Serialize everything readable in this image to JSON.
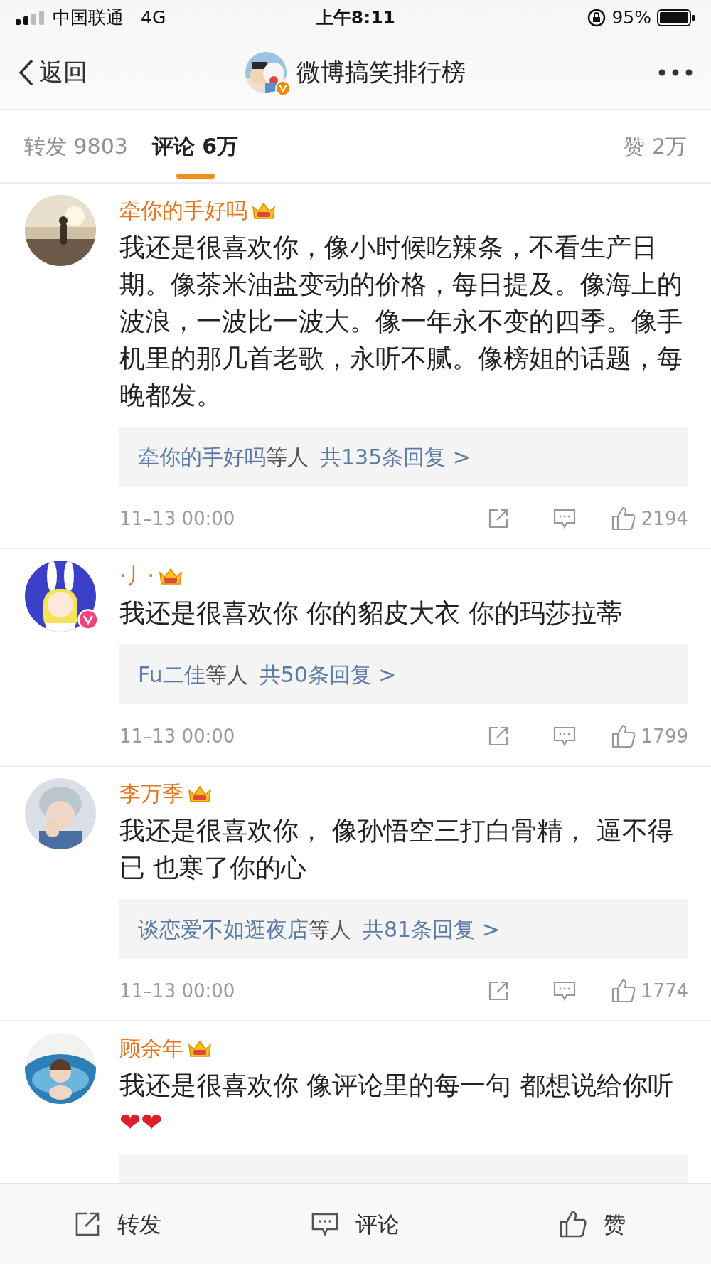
{
  "status_bar": {
    "carrier": "中国联通",
    "network": "4G",
    "time": "上午8:11",
    "battery": "95%"
  },
  "nav": {
    "back": "返回",
    "title": "微博搞笑排行榜",
    "verified": true
  },
  "tabs": [
    {
      "label": "转发 9803",
      "selected": false
    },
    {
      "label": "评论 6万",
      "selected": true
    },
    {
      "label": "赞 2万",
      "selected": false
    }
  ],
  "comments": [
    {
      "user": "牵你的手好吗",
      "vip": true,
      "verified": false,
      "text": "我还是很喜欢你，像小时候吃辣条，不看生产日期。像茶米油盐变动的价格，每日提及。像海上的波浪，一波比一波大。像一年永不变的四季。像手机里的那几首老歌，永听不腻。像榜姐的话题，每晚都发。",
      "replies": {
        "users": "牵你的手好吗",
        "suffix": "等人",
        "total": "共135条回复 >"
      },
      "time": "11–13 00:00",
      "likes": "2194"
    },
    {
      "user": "·丿·",
      "vip": true,
      "verified": true,
      "text": "我还是很喜欢你 你的貂皮大衣 你的玛莎拉蒂",
      "replies": {
        "users": "Fu二佳",
        "suffix": "等人",
        "total": "共50条回复 >"
      },
      "time": "11–13 00:00",
      "likes": "1799"
    },
    {
      "user": "李万季",
      "vip": true,
      "verified": false,
      "text": "我还是很喜欢你，  像孙悟空三打白骨精，  逼不得已 也寒了你的心",
      "replies": {
        "users": "谈恋爱不如逛夜店",
        "suffix": "等人",
        "total": "共81条回复 >"
      },
      "time": "11–13 00:00",
      "likes": "1774"
    },
    {
      "user": "顾余年",
      "vip": true,
      "verified": false,
      "text": "我还是很喜欢你 像评论里的每一句 都想说给你听",
      "emoji": "❤❤",
      "replies_hidden": true
    }
  ],
  "actions": [
    {
      "kind": "repost",
      "label": "转发"
    },
    {
      "kind": "comment",
      "label": "评论"
    },
    {
      "kind": "like",
      "label": "赞"
    }
  ]
}
